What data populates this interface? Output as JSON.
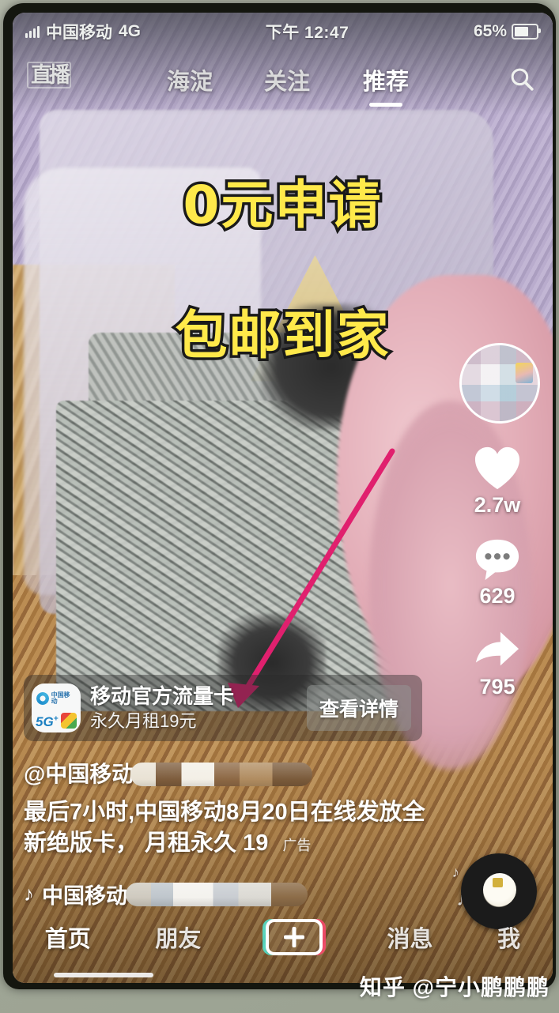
{
  "status_bar": {
    "carrier": "中国移动",
    "network": "4G",
    "time": "下午 12:47",
    "battery_percent": "65%",
    "battery_level": 65,
    "signal_bars": 4
  },
  "top_nav": {
    "live_label": "直播",
    "tabs": [
      {
        "label": "海淀",
        "active": false
      },
      {
        "label": "关注",
        "active": false
      },
      {
        "label": "推荐",
        "active": true
      }
    ],
    "search_icon": "search-icon"
  },
  "video_overlay": {
    "promo_line_1": "0元申请",
    "promo_line_2": "包邮到家",
    "promo_text_color": "#ffe94a",
    "promo_outline_color": "#1a1a1a",
    "arrow_color": "#e0206e"
  },
  "action_rail": {
    "avatar": "blurred-avatar",
    "like": {
      "icon": "heart-icon",
      "count": "2.7w"
    },
    "comment": {
      "icon": "comment-icon",
      "count": "629"
    },
    "share": {
      "icon": "share-icon",
      "count": "795"
    },
    "music_disc": "music-disc"
  },
  "ad_card": {
    "logo": "china-mobile-logo",
    "logo_text": "中国移动",
    "logo_badge": "5G",
    "title": "移动官方流量卡",
    "subtitle": "永久月租19元",
    "button_label": "查看详情"
  },
  "caption": {
    "author": "@中国移动",
    "author_masked": true,
    "description": "最后7小时,中国移动8月20日在线发放全新绝版卡， 月租永久 19",
    "ad_tag": "广告",
    "music_icon": "music-note-icon",
    "music_title": "中国移动",
    "music_masked": true
  },
  "bottom_nav": {
    "items": [
      {
        "label": "首页",
        "active": true
      },
      {
        "label": "朋友",
        "active": false
      },
      {
        "label": "+",
        "active": false,
        "is_plus": true
      },
      {
        "label": "消息",
        "active": false
      },
      {
        "label": "我",
        "active": false
      }
    ]
  },
  "watermark": {
    "text": "知乎 @宁小鹏鹏鹏"
  }
}
